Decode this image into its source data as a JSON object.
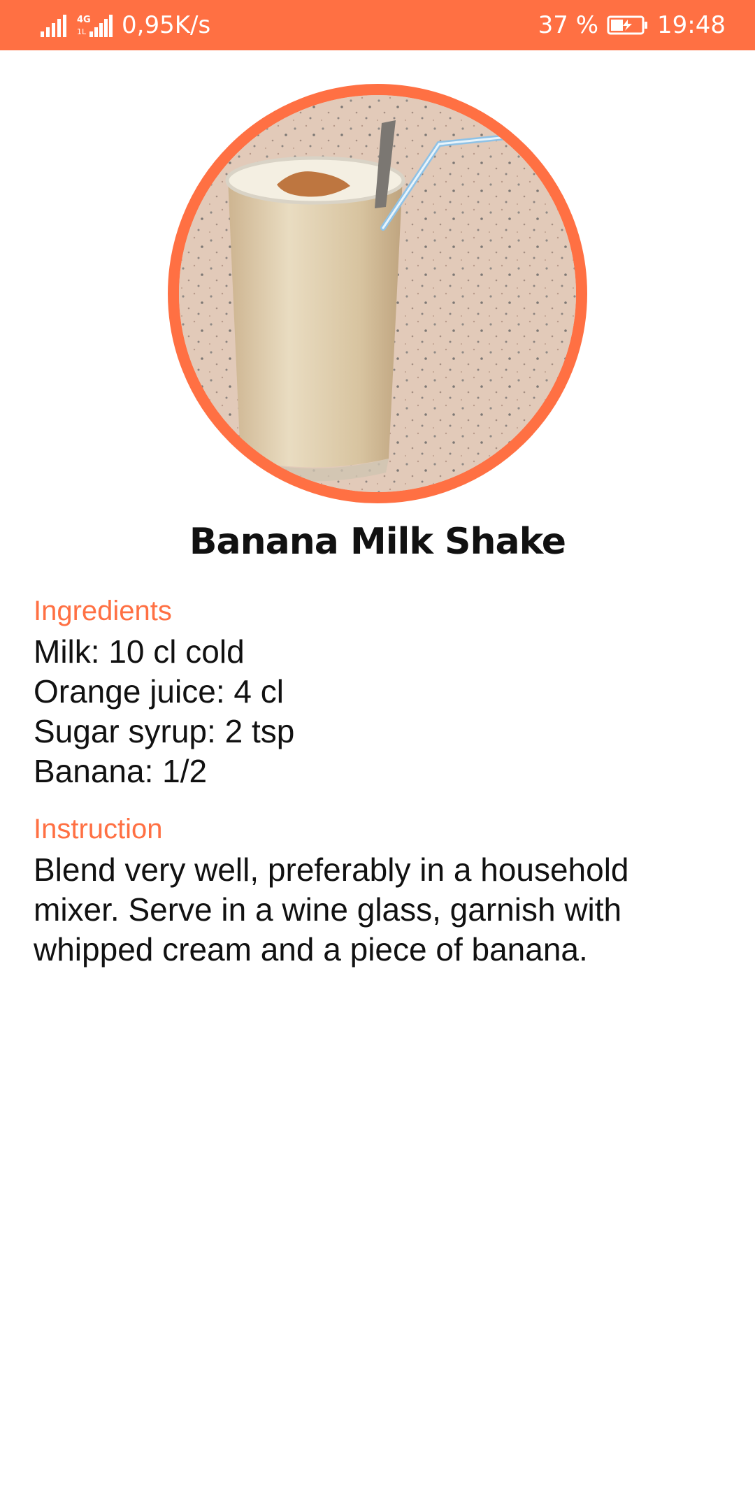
{
  "status_bar": {
    "network_speed": "0,95K/s",
    "network_type": "4G",
    "battery_percent": "37 %",
    "time": "19:48",
    "icons": [
      "signal-icon",
      "signal-4g-icon",
      "battery-charging-icon"
    ],
    "background_color": "#FF7043"
  },
  "recipe": {
    "image_icon": "milkshake-photo",
    "title": "Banana Milk Shake",
    "accent_color": "#FF7043",
    "ingredients_heading": "Ingredients",
    "ingredients": [
      "Milk: 10 cl cold",
      "Orange juice: 4 cl",
      "Sugar syrup: 2 tsp",
      "Banana: 1/2"
    ],
    "instruction_heading": "Instruction",
    "instruction_text": "Blend very well, preferably in a household mixer. Serve in a wine glass, garnish with whipped cream and a piece of banana."
  }
}
